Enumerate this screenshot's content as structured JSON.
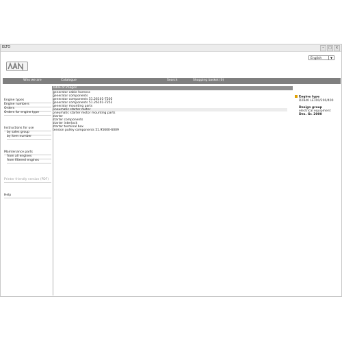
{
  "window": {
    "title": "ELTO",
    "controls": [
      "–",
      "□",
      "×"
    ]
  },
  "language": {
    "selected": "English"
  },
  "nav": [
    "Who we are",
    "Catalogue",
    "Search",
    "Shopping basket (0)"
  ],
  "sidebar": {
    "groups": [
      [
        "Engine types",
        "Engine numbers",
        "Orders",
        "Orders for engine type"
      ],
      [
        "Instructions for use",
        "by sales group",
        "by item number"
      ],
      [
        "Maintenance parts",
        "from all engines",
        "from filtered engines"
      ],
      [
        "Printer friendly version (PDF)"
      ],
      [
        "Help"
      ]
    ]
  },
  "table": {
    "header": "Table of images",
    "rows": [
      "generator cable harness",
      "generator components",
      "generator components 51.26101-7205",
      "generator components 51.26101-7252",
      "generator mounting parts",
      "pneumatic starter motor",
      "pneumatic starter motor mounting parts",
      "starter",
      "starter components",
      "starter interlock",
      "starter terminal box",
      "tension pulley components 51.95600-6009"
    ]
  },
  "details": {
    "engine_type_label": "Engine type",
    "engine_type_value": "D2840 LE100/200/400",
    "design_group_label": "Design group",
    "design_group_value": "electrical equipment",
    "des_gr_label": "Des. Gr. 2000"
  },
  "colors": {
    "navbar": "#7f7f7f",
    "header": "#8f8f8f",
    "bullet": "#e0a000"
  }
}
